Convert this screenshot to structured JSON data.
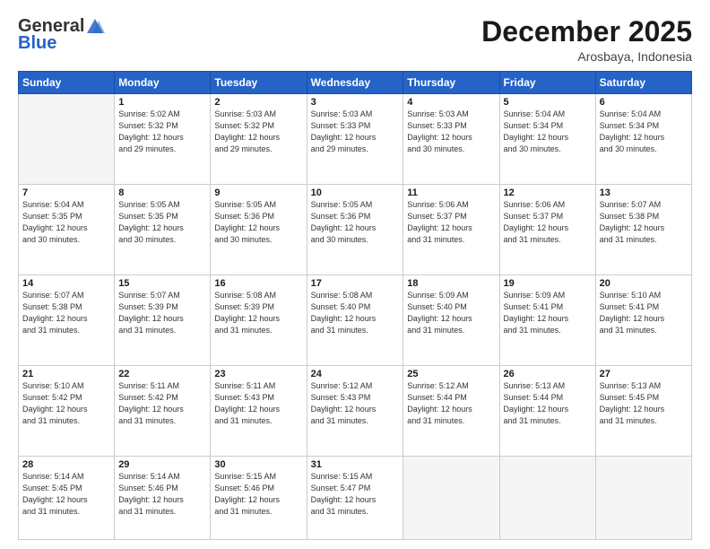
{
  "header": {
    "logo_general": "General",
    "logo_blue": "Blue",
    "month_title": "December 2025",
    "location": "Arosbaya, Indonesia"
  },
  "days_of_week": [
    "Sunday",
    "Monday",
    "Tuesday",
    "Wednesday",
    "Thursday",
    "Friday",
    "Saturday"
  ],
  "weeks": [
    [
      {
        "day": "",
        "info": ""
      },
      {
        "day": "1",
        "info": "Sunrise: 5:02 AM\nSunset: 5:32 PM\nDaylight: 12 hours\nand 29 minutes."
      },
      {
        "day": "2",
        "info": "Sunrise: 5:03 AM\nSunset: 5:32 PM\nDaylight: 12 hours\nand 29 minutes."
      },
      {
        "day": "3",
        "info": "Sunrise: 5:03 AM\nSunset: 5:33 PM\nDaylight: 12 hours\nand 29 minutes."
      },
      {
        "day": "4",
        "info": "Sunrise: 5:03 AM\nSunset: 5:33 PM\nDaylight: 12 hours\nand 30 minutes."
      },
      {
        "day": "5",
        "info": "Sunrise: 5:04 AM\nSunset: 5:34 PM\nDaylight: 12 hours\nand 30 minutes."
      },
      {
        "day": "6",
        "info": "Sunrise: 5:04 AM\nSunset: 5:34 PM\nDaylight: 12 hours\nand 30 minutes."
      }
    ],
    [
      {
        "day": "7",
        "info": "Sunrise: 5:04 AM\nSunset: 5:35 PM\nDaylight: 12 hours\nand 30 minutes."
      },
      {
        "day": "8",
        "info": "Sunrise: 5:05 AM\nSunset: 5:35 PM\nDaylight: 12 hours\nand 30 minutes."
      },
      {
        "day": "9",
        "info": "Sunrise: 5:05 AM\nSunset: 5:36 PM\nDaylight: 12 hours\nand 30 minutes."
      },
      {
        "day": "10",
        "info": "Sunrise: 5:05 AM\nSunset: 5:36 PM\nDaylight: 12 hours\nand 30 minutes."
      },
      {
        "day": "11",
        "info": "Sunrise: 5:06 AM\nSunset: 5:37 PM\nDaylight: 12 hours\nand 31 minutes."
      },
      {
        "day": "12",
        "info": "Sunrise: 5:06 AM\nSunset: 5:37 PM\nDaylight: 12 hours\nand 31 minutes."
      },
      {
        "day": "13",
        "info": "Sunrise: 5:07 AM\nSunset: 5:38 PM\nDaylight: 12 hours\nand 31 minutes."
      }
    ],
    [
      {
        "day": "14",
        "info": "Sunrise: 5:07 AM\nSunset: 5:38 PM\nDaylight: 12 hours\nand 31 minutes."
      },
      {
        "day": "15",
        "info": "Sunrise: 5:07 AM\nSunset: 5:39 PM\nDaylight: 12 hours\nand 31 minutes."
      },
      {
        "day": "16",
        "info": "Sunrise: 5:08 AM\nSunset: 5:39 PM\nDaylight: 12 hours\nand 31 minutes."
      },
      {
        "day": "17",
        "info": "Sunrise: 5:08 AM\nSunset: 5:40 PM\nDaylight: 12 hours\nand 31 minutes."
      },
      {
        "day": "18",
        "info": "Sunrise: 5:09 AM\nSunset: 5:40 PM\nDaylight: 12 hours\nand 31 minutes."
      },
      {
        "day": "19",
        "info": "Sunrise: 5:09 AM\nSunset: 5:41 PM\nDaylight: 12 hours\nand 31 minutes."
      },
      {
        "day": "20",
        "info": "Sunrise: 5:10 AM\nSunset: 5:41 PM\nDaylight: 12 hours\nand 31 minutes."
      }
    ],
    [
      {
        "day": "21",
        "info": "Sunrise: 5:10 AM\nSunset: 5:42 PM\nDaylight: 12 hours\nand 31 minutes."
      },
      {
        "day": "22",
        "info": "Sunrise: 5:11 AM\nSunset: 5:42 PM\nDaylight: 12 hours\nand 31 minutes."
      },
      {
        "day": "23",
        "info": "Sunrise: 5:11 AM\nSunset: 5:43 PM\nDaylight: 12 hours\nand 31 minutes."
      },
      {
        "day": "24",
        "info": "Sunrise: 5:12 AM\nSunset: 5:43 PM\nDaylight: 12 hours\nand 31 minutes."
      },
      {
        "day": "25",
        "info": "Sunrise: 5:12 AM\nSunset: 5:44 PM\nDaylight: 12 hours\nand 31 minutes."
      },
      {
        "day": "26",
        "info": "Sunrise: 5:13 AM\nSunset: 5:44 PM\nDaylight: 12 hours\nand 31 minutes."
      },
      {
        "day": "27",
        "info": "Sunrise: 5:13 AM\nSunset: 5:45 PM\nDaylight: 12 hours\nand 31 minutes."
      }
    ],
    [
      {
        "day": "28",
        "info": "Sunrise: 5:14 AM\nSunset: 5:45 PM\nDaylight: 12 hours\nand 31 minutes."
      },
      {
        "day": "29",
        "info": "Sunrise: 5:14 AM\nSunset: 5:46 PM\nDaylight: 12 hours\nand 31 minutes."
      },
      {
        "day": "30",
        "info": "Sunrise: 5:15 AM\nSunset: 5:46 PM\nDaylight: 12 hours\nand 31 minutes."
      },
      {
        "day": "31",
        "info": "Sunrise: 5:15 AM\nSunset: 5:47 PM\nDaylight: 12 hours\nand 31 minutes."
      },
      {
        "day": "",
        "info": ""
      },
      {
        "day": "",
        "info": ""
      },
      {
        "day": "",
        "info": ""
      }
    ]
  ]
}
